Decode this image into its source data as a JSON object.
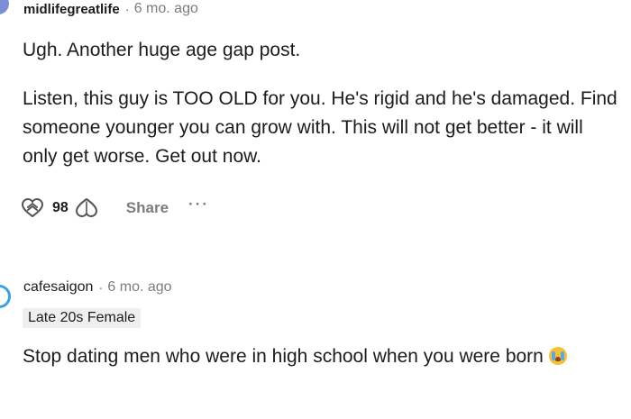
{
  "comments": [
    {
      "username": "midlifegreatlife",
      "separator": "·",
      "time": "6 mo. ago",
      "paragraphs": [
        "Ugh. Another huge age gap post.",
        "Listen, this guy is TOO OLD for you. He's rigid and he's damaged. Find someone younger you can grow with. This will not get better - it will only get worse. Get out now."
      ],
      "votes": "98",
      "share_label": "Share",
      "more_label": "···",
      "icons": {
        "upvote": "heart-upvote-icon",
        "downvote": "heart-downvote-icon"
      }
    },
    {
      "username": "cafesaigon",
      "separator": "·",
      "time": "6 mo. ago",
      "flair": "Late 20s Female",
      "body_text": "Stop dating men who were in high school when you were born",
      "emoji": "loudly-crying-face-icon"
    }
  ],
  "colors": {
    "text": "#1c1c1c",
    "meta": "#7c7c7c",
    "flair_bg": "#edeff1",
    "avatar1": "#7b8ed6",
    "avatar2_ring": "#3aa0e8"
  }
}
